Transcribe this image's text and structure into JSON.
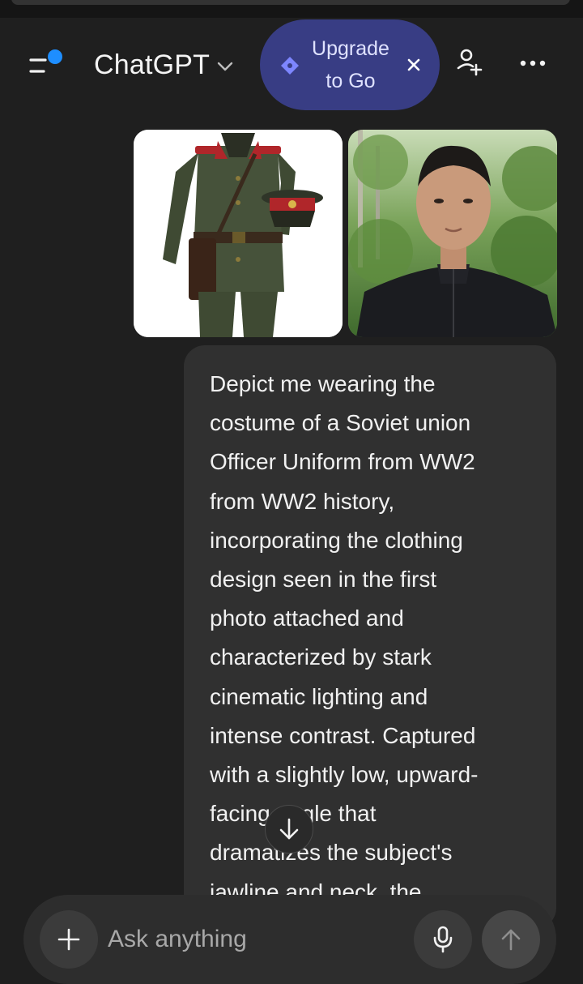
{
  "header": {
    "model_name": "ChatGPT",
    "upgrade_label": "Upgrade\nto Go"
  },
  "attachments": [
    {
      "name": "uniform-image",
      "depicts": "soviet-officer-uniform-with-cap"
    },
    {
      "name": "user-photo",
      "depicts": "portrait-in-black-jacket"
    }
  ],
  "message": {
    "role": "user",
    "text": "Depict me wearing the\ncostume of a Soviet union\nOfficer Uniform from WW2\nfrom WW2 history,\nincorporating the clothing\ndesign seen in the first\nphoto attached and\ncharacterized by stark\ncinematic lighting and\nintense contrast. Captured\nwith a slightly low, upward-\nfacing angle that\ndramatizes the subject's\njawline and neck, the"
  },
  "composer": {
    "placeholder": "Ask anything",
    "value": ""
  },
  "icons": {
    "menu": "sidebar-menu-icon",
    "model_dropdown": "chevron-down-icon",
    "upgrade": "diamond-icon",
    "close": "close-icon",
    "new_chat": "add-person-icon",
    "more": "more-options-icon",
    "scroll_down": "arrow-down-icon",
    "attach": "plus-icon",
    "voice": "microphone-icon",
    "send": "arrow-up-icon"
  },
  "colors": {
    "background": "#1f1f1f",
    "upgrade_pill": "#383d84",
    "badge_dot": "#1e8eff",
    "bubble": "#303030",
    "composer": "#2d2d2d"
  }
}
